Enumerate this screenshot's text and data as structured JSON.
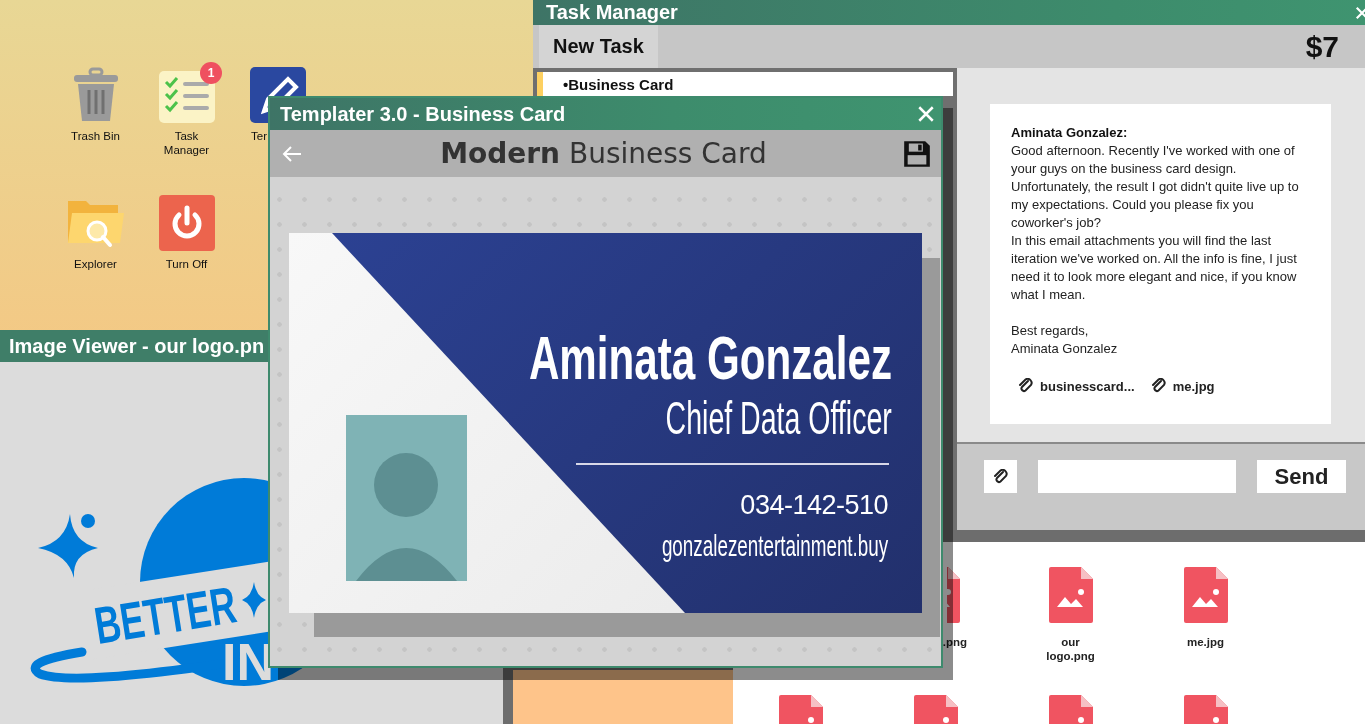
{
  "desktop": {
    "icons": [
      {
        "kind": "trash",
        "label": "Trash Bin"
      },
      {
        "kind": "tasks",
        "label": "Task Manager",
        "badge": "1"
      },
      {
        "kind": "templater",
        "label": "Ter"
      },
      {
        "kind": "explorer",
        "label": "Explorer"
      },
      {
        "kind": "power",
        "label": "Turn Off"
      }
    ]
  },
  "image_viewer": {
    "title": "Image Viewer - our logo.pn",
    "logo_words": [
      "BETTER",
      "IN"
    ]
  },
  "explorer": {
    "files": [
      {
        "kind": "image",
        "name": ".png"
      },
      {
        "kind": "image",
        "name": "our logo.png"
      },
      {
        "kind": "image",
        "name": "me.jpg"
      },
      {
        "kind": "image"
      },
      {
        "kind": "image"
      },
      {
        "kind": "image"
      },
      {
        "kind": "image"
      }
    ]
  },
  "task_manager": {
    "title": "Task Manager",
    "new_task_button": "New Task",
    "balance": "$7",
    "tasks": [
      {
        "label": "•Business Card",
        "selected": true
      }
    ],
    "email": {
      "sender": "Aminata Gonzalez:",
      "body": [
        "Good afternoon. Recently I've worked with one of your guys on the business card design. Unfortunately, the result I got didn't quite live up to my expectations. Could you please fix you coworker's job?",
        "In this email attachments you will find the last iteration we've worked on. All the info is fine, I just need it to look more elegant and nice, if you know what I mean."
      ],
      "closing": [
        "Best regards,",
        "Aminata Gonzalez"
      ],
      "attachments": [
        {
          "name": "businesscard..."
        },
        {
          "name": "me.jpg"
        }
      ]
    },
    "reply": {
      "send_button": "Send"
    }
  },
  "templater": {
    "title": "Templater 3.0 - Business Card",
    "heading": "**Modern** Business Card",
    "card": {
      "name": "Aminata Gonzalez",
      "job_title": "Chief Data Officer",
      "phone": "034-142-510",
      "website": "gonzalezentertainment.buy"
    }
  }
}
